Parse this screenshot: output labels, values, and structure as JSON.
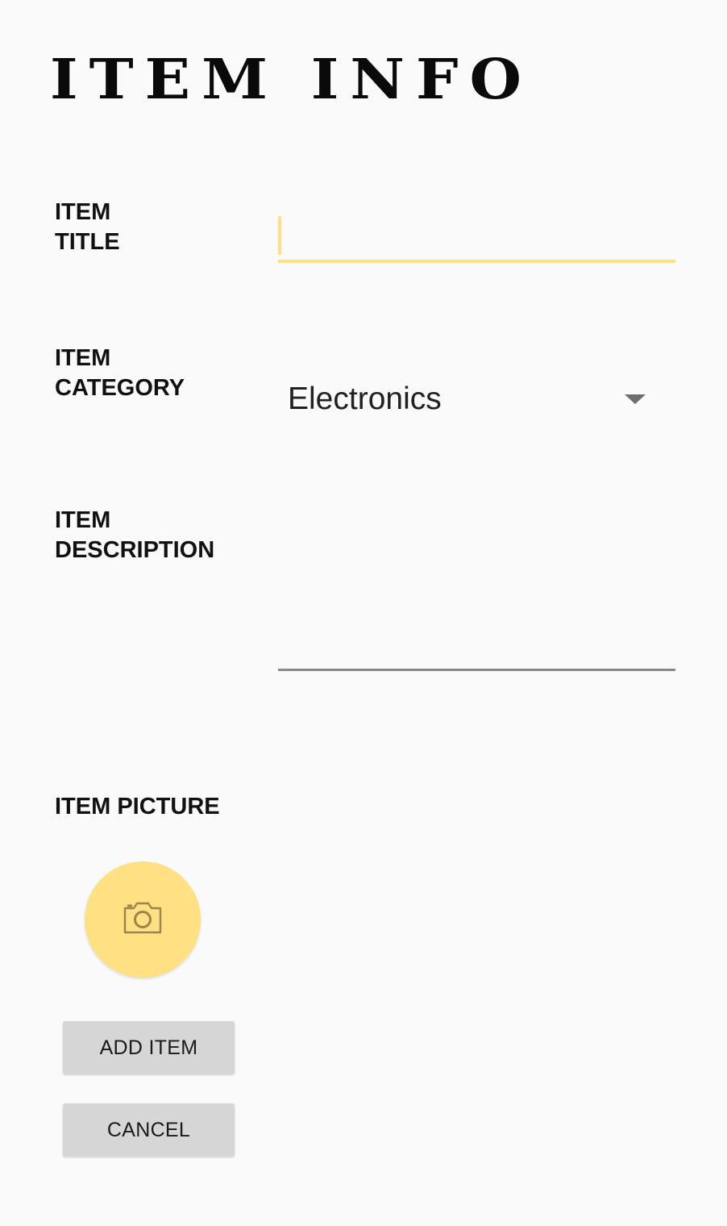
{
  "header": {
    "title": "ITEM INFO"
  },
  "form": {
    "title_label": "ITEM\nTITLE",
    "title_value": "",
    "category_label": "ITEM\nCATEGORY",
    "category_value": "Electronics",
    "description_label": "ITEM\nDESCRIPTION",
    "description_value": "",
    "picture_label": "ITEM PICTURE"
  },
  "icons": {
    "camera": "camera-icon",
    "dropdown": "dropdown-caret-icon"
  },
  "actions": {
    "add_label": "ADD ITEM",
    "cancel_label": "CANCEL"
  },
  "colors": {
    "accent": "#ffe082",
    "button_bg": "#d6d6d6",
    "background": "#fafafa"
  }
}
